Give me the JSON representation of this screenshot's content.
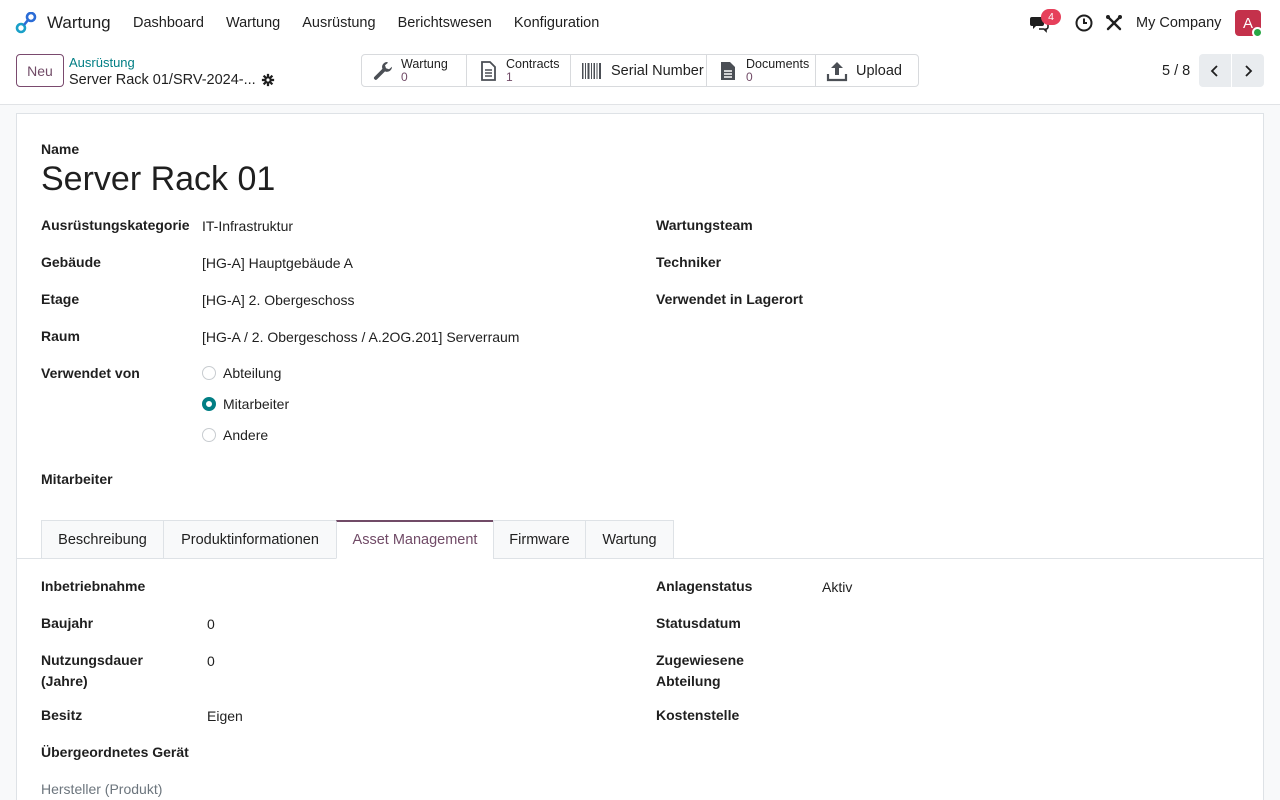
{
  "navbar": {
    "app_name": "Wartung",
    "menu": [
      "Dashboard",
      "Wartung",
      "Ausrüstung",
      "Berichtswesen",
      "Konfiguration"
    ],
    "messages_badge": "4",
    "company": "My Company",
    "avatar_letter": "A"
  },
  "control": {
    "new_label": "Neu",
    "breadcrumb_parent": "Ausrüstung",
    "record_name": "Server Rack 01/SRV-2024-...",
    "smart_buttons": {
      "wartung": {
        "label": "Wartung",
        "count": "0"
      },
      "contracts": {
        "label": "Contracts",
        "count": "1"
      },
      "serial": {
        "label": "Serial Number"
      },
      "documents": {
        "label": "Documents",
        "count": "0"
      },
      "upload": {
        "label": "Upload"
      }
    },
    "pager": "5 / 8"
  },
  "form": {
    "name_label": "Name",
    "name_value": "Server Rack 01",
    "left": {
      "kategorie_label": "Ausrüstungskategorie",
      "kategorie_value": "IT-Infrastruktur",
      "gebaeude_label": "Gebäude",
      "gebaeude_value": "[HG-A] Hauptgebäude A",
      "etage_label": "Etage",
      "etage_value": "[HG-A] 2. Obergeschoss",
      "raum_label": "Raum",
      "raum_value": "[HG-A / 2. Obergeschoss / A.2OG.201] Serverraum",
      "verwendet_von_label": "Verwendet von",
      "radio_options": [
        "Abteilung",
        "Mitarbeiter",
        "Andere"
      ],
      "radio_selected": "Mitarbeiter",
      "mitarbeiter_label": "Mitarbeiter"
    },
    "right": {
      "wartungsteam_label": "Wartungsteam",
      "techniker_label": "Techniker",
      "lagerort_label": "Verwendet in Lagerort"
    },
    "tabs": [
      "Beschreibung",
      "Produktinformationen",
      "Asset Management",
      "Firmware",
      "Wartung"
    ],
    "active_tab": "Asset Management",
    "asset": {
      "inbetriebnahme_label": "Inbetriebnahme",
      "baujahr_label": "Baujahr",
      "baujahr_value": "0",
      "nutzungsdauer_label_1": "Nutzungsdauer",
      "nutzungsdauer_label_2": "(Jahre)",
      "nutzungsdauer_value": "0",
      "besitz_label": "Besitz",
      "besitz_value": "Eigen",
      "uebergeordnet_label": "Übergeordnetes Gerät",
      "hersteller_label": "Hersteller (Produkt)",
      "anlagenstatus_label": "Anlagenstatus",
      "anlagenstatus_value": "Aktiv",
      "statusdatum_label": "Statusdatum",
      "zugewiesene_label_1": "Zugewiesene",
      "zugewiesene_label_2": "Abteilung",
      "kostenstelle_label": "Kostenstelle"
    }
  },
  "colors": {
    "primary": "#714b67",
    "teal": "#017e84",
    "badge": "#e6405b",
    "avatar": "#c4314b"
  }
}
